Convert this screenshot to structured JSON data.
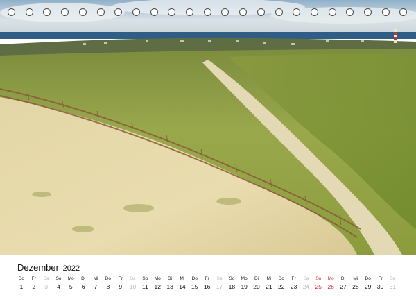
{
  "photo": {
    "subject": "dune-landscape-photo"
  },
  "binding": {
    "ring_count": 23,
    "icon": "spiral-binding-ring-icon"
  },
  "calendar": {
    "month": "Dezember",
    "year": "2022",
    "colors": {
      "text": "#111111",
      "weekend": "#b9b9b9",
      "holiday": "#d2202a"
    },
    "days": [
      {
        "name": "Do",
        "num": "1",
        "kind": "normal"
      },
      {
        "name": "Fr",
        "num": "2",
        "kind": "normal"
      },
      {
        "name": "Sa",
        "num": "3",
        "kind": "weekend"
      },
      {
        "name": "So",
        "num": "4",
        "kind": "normal"
      },
      {
        "name": "Mo",
        "num": "5",
        "kind": "normal"
      },
      {
        "name": "Di",
        "num": "6",
        "kind": "normal"
      },
      {
        "name": "Mi",
        "num": "7",
        "kind": "normal"
      },
      {
        "name": "Do",
        "num": "8",
        "kind": "normal"
      },
      {
        "name": "Fr",
        "num": "9",
        "kind": "normal"
      },
      {
        "name": "Sa",
        "num": "10",
        "kind": "weekend"
      },
      {
        "name": "So",
        "num": "11",
        "kind": "normal"
      },
      {
        "name": "Mo",
        "num": "12",
        "kind": "normal"
      },
      {
        "name": "Di",
        "num": "13",
        "kind": "normal"
      },
      {
        "name": "Mi",
        "num": "14",
        "kind": "normal"
      },
      {
        "name": "Do",
        "num": "15",
        "kind": "normal"
      },
      {
        "name": "Fr",
        "num": "16",
        "kind": "normal"
      },
      {
        "name": "Sa",
        "num": "17",
        "kind": "weekend"
      },
      {
        "name": "So",
        "num": "18",
        "kind": "normal"
      },
      {
        "name": "Mo",
        "num": "19",
        "kind": "normal"
      },
      {
        "name": "Di",
        "num": "20",
        "kind": "normal"
      },
      {
        "name": "Mi",
        "num": "21",
        "kind": "normal"
      },
      {
        "name": "Do",
        "num": "22",
        "kind": "normal"
      },
      {
        "name": "Fr",
        "num": "23",
        "kind": "normal"
      },
      {
        "name": "Sa",
        "num": "24",
        "kind": "weekend"
      },
      {
        "name": "So",
        "num": "25",
        "kind": "holiday"
      },
      {
        "name": "Mo",
        "num": "26",
        "kind": "holiday"
      },
      {
        "name": "Di",
        "num": "27",
        "kind": "normal"
      },
      {
        "name": "Mi",
        "num": "28",
        "kind": "normal"
      },
      {
        "name": "Do",
        "num": "29",
        "kind": "normal"
      },
      {
        "name": "Fr",
        "num": "30",
        "kind": "normal"
      },
      {
        "name": "Sa",
        "num": "31",
        "kind": "weekend"
      }
    ]
  }
}
